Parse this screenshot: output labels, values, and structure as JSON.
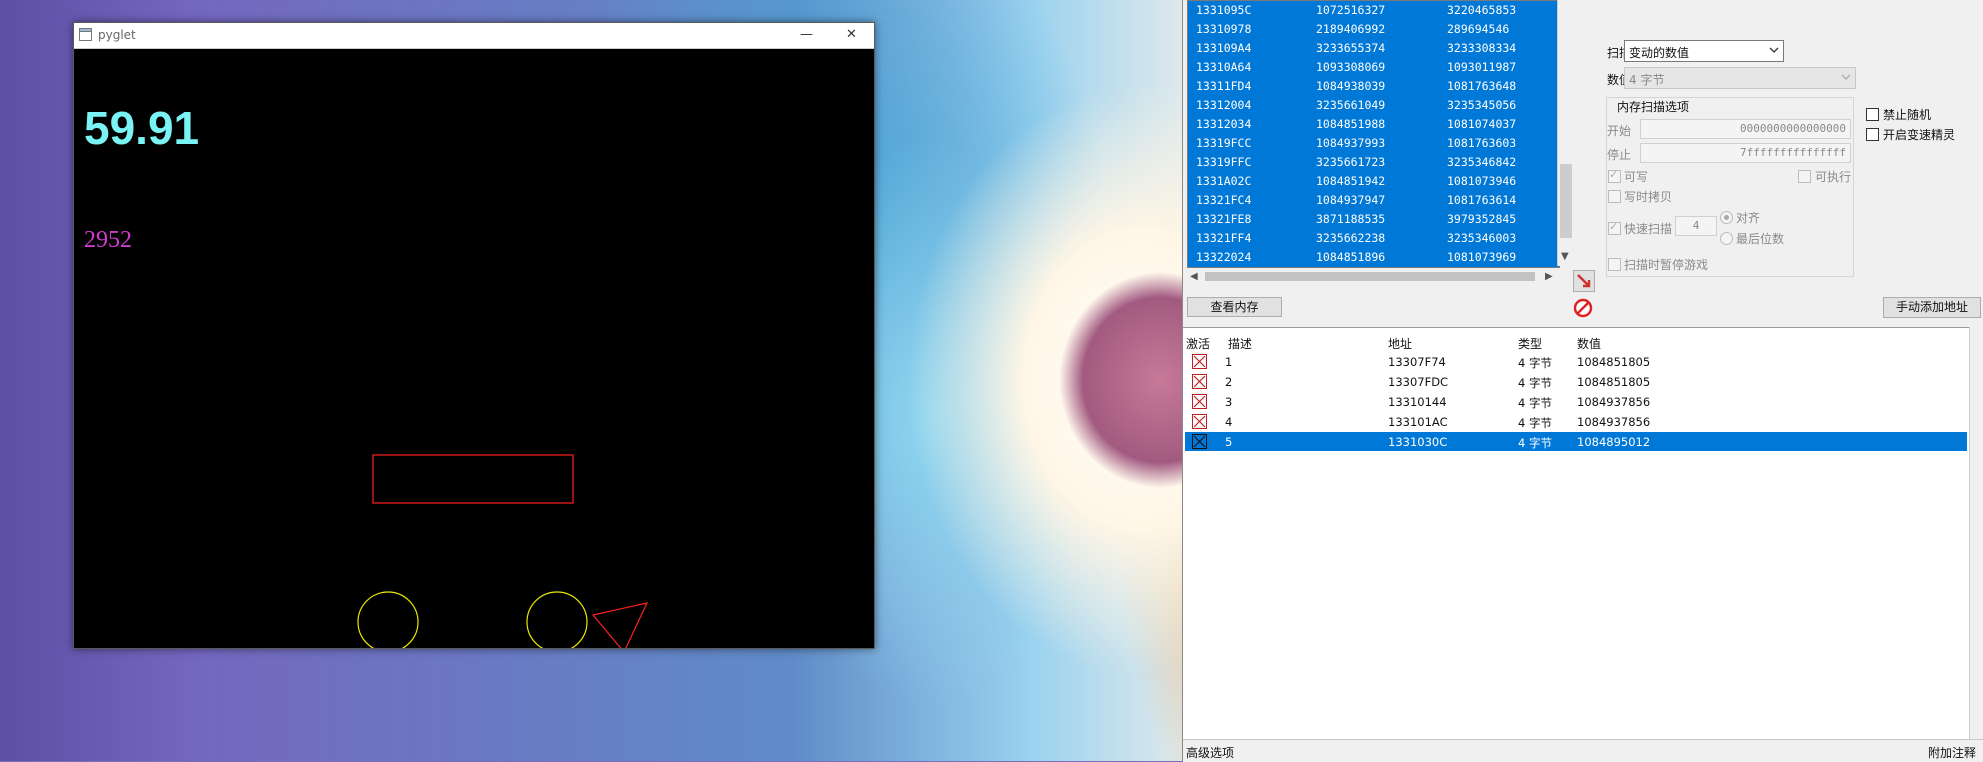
{
  "pyglet_window": {
    "title": "pyglet",
    "fps": "59.91",
    "counter": "2952",
    "colors": {
      "fps": "#79f3f3",
      "counter": "#d13bd0",
      "rect": "#ff2020",
      "circle": "#e8e800",
      "triangle": "#ff2020",
      "ground": "#e8e800"
    }
  },
  "cheat_engine": {
    "scan_results": [
      [
        "1331095C",
        "1072516327",
        "3220465853"
      ],
      [
        "13310978",
        "2189406992",
        "289694546"
      ],
      [
        "133109A4",
        "3233655374",
        "3233308334"
      ],
      [
        "13310A64",
        "1093308069",
        "1093011987"
      ],
      [
        "13311FD4",
        "1084938039",
        "1081763648"
      ],
      [
        "13312004",
        "3235661049",
        "3235345056"
      ],
      [
        "13312034",
        "1084851988",
        "1081074037"
      ],
      [
        "13319FCC",
        "1084937993",
        "1081763603"
      ],
      [
        "13319FFC",
        "3235661723",
        "3235346842"
      ],
      [
        "1331A02C",
        "1084851942",
        "1081073946"
      ],
      [
        "13321FC4",
        "1084937947",
        "1081763614"
      ],
      [
        "13321FE8",
        "3871188535",
        "3979352845"
      ],
      [
        "13321FF4",
        "3235662238",
        "3235346003"
      ],
      [
        "13322024",
        "1084851896",
        "1081073969"
      ]
    ],
    "memory_view_label": "查看内存",
    "manual_add_label": "手动添加地址",
    "scan_type_label": "扫描类型",
    "scan_type_value": "变动的数值",
    "value_type_label": "数值类型",
    "value_type_value": "4 字节",
    "mem_scan_options_title": "内存扫描选项",
    "start_label": "开始",
    "start_value": "0000000000000000",
    "stop_label": "停止",
    "stop_value": "7fffffffffffffff",
    "writable_label": "可写",
    "executable_label": "可执行",
    "copy_on_write_label": "写时拷贝",
    "fast_scan_label": "快速扫描",
    "fast_scan_value": "4",
    "align_label": "对齐",
    "last_digits_label": "最后位数",
    "pause_game_label": "扫描时暂停游戏",
    "disable_random_label": "禁止随机",
    "speedhack_label": "开启变速精灵",
    "address_list": {
      "headers": {
        "active": "激活",
        "description": "描述",
        "address": "地址",
        "type": "类型",
        "value": "数值"
      },
      "rows": [
        {
          "description": "1",
          "address": "13307F74",
          "type": "4 字节",
          "value": "1084851805"
        },
        {
          "description": "2",
          "address": "13307FDC",
          "type": "4 字节",
          "value": "1084851805"
        },
        {
          "description": "3",
          "address": "13310144",
          "type": "4 字节",
          "value": "1084937856"
        },
        {
          "description": "4",
          "address": "133101AC",
          "type": "4 字节",
          "value": "1084937856"
        },
        {
          "description": "5",
          "address": "1331030C",
          "type": "4 字节",
          "value": "1084895012"
        }
      ]
    },
    "advanced_options_label": "高级选项",
    "add_comment_label": "附加注释",
    "selection_color": "#0078d7"
  }
}
